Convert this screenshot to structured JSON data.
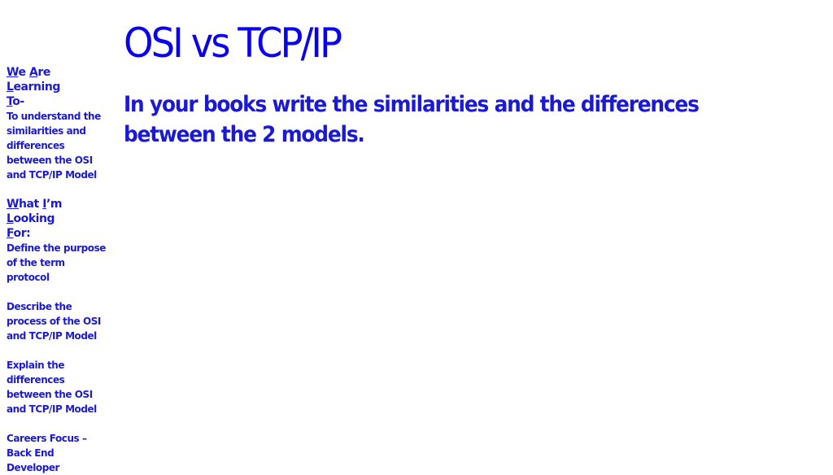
{
  "title": "OSI vs TCP/IP",
  "instruction": "In your books write the similarities and the differences between the 2 models.",
  "sidebar": {
    "walt": {
      "heading_parts": [
        {
          "u": "W",
          "rest": "e "
        },
        {
          "u": "A",
          "rest": "re "
        },
        {
          "u": "L",
          "rest": "earning"
        },
        {
          "u": "T",
          "rest": "o-"
        }
      ],
      "body": "To understand the similarities and differences between the OSI and TCP/IP Model"
    },
    "wilf": {
      "heading_parts": [
        {
          "u": "W",
          "rest": "hat "
        },
        {
          "u": "I",
          "rest": "’m "
        },
        {
          "u": "L",
          "rest": "ooking"
        },
        {
          "u": "F",
          "rest": "or:"
        }
      ],
      "items": [
        "Define the purpose of the term protocol",
        "Describe the process of the OSI and TCP/IP Model",
        "Explain the differences between the OSI and TCP/IP Model",
        "Careers Focus – Back End Developer"
      ]
    }
  },
  "colors": {
    "title": "#0a00f0",
    "text": "#1a1ad6",
    "background": "#ffffff"
  }
}
